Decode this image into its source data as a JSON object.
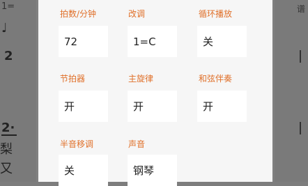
{
  "background": {
    "top_left": "1=",
    "note_glyph": "♩",
    "measure_num_1": "2",
    "measure_num_2": "2·",
    "lyric_line_1": "梨",
    "lyric_line_2": "又",
    "right_top": "谱"
  },
  "settings": {
    "fields": [
      {
        "label": "拍数/分钟",
        "value": "72"
      },
      {
        "label": "改调",
        "value": "1=C"
      },
      {
        "label": "循环播放",
        "value": "关"
      },
      {
        "label": "节拍器",
        "value": "开"
      },
      {
        "label": "主旋律",
        "value": "开"
      },
      {
        "label": "和弦伴奏",
        "value": "开"
      },
      {
        "label": "半音移调",
        "value": "关"
      },
      {
        "label": "声音",
        "value": "钢琴"
      }
    ]
  },
  "colors": {
    "accent": "#e0702a",
    "overlay": "#808080",
    "panel": "#f6f6f6",
    "box": "#ffffff"
  }
}
